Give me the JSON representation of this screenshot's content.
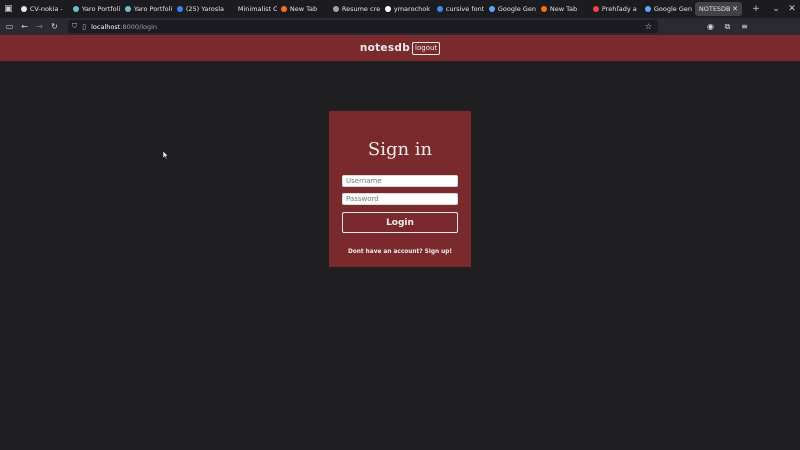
{
  "browser": {
    "tabs": [
      {
        "label": "CV-nokia -",
        "color": "#e8e8e8"
      },
      {
        "label": "Yaro Portfoli",
        "color": "#6ec0c7"
      },
      {
        "label": "Yaro Portfoli",
        "color": "#6ec0c7"
      },
      {
        "label": "(25) Yarosla",
        "color": "#3b82f6"
      },
      {
        "label": "Minimalist C",
        "color": "#1c1b1f"
      },
      {
        "label": "New Tab",
        "color": "#f97316"
      },
      {
        "label": "Resume cre",
        "color": "#9ca3af"
      },
      {
        "label": "ymarochok",
        "color": "#ffffff"
      },
      {
        "label": "cursive font",
        "color": "#4285f4"
      },
      {
        "label": "Google Gen",
        "color": "#60a5fa"
      },
      {
        "label": "New Tab",
        "color": "#f97316"
      },
      {
        "label": "Prehľady a",
        "color": "#ef4444"
      },
      {
        "label": "Google Gen",
        "color": "#60a5fa"
      }
    ],
    "active_tab": "NOTESDB",
    "url_host": "localhost",
    "url_rest": ":8000/login"
  },
  "header": {
    "brand": "notesdb",
    "logout_label": "logout",
    "accent_color": "#7a2a2c"
  },
  "login": {
    "title": "Sign in",
    "username_placeholder": "Username",
    "password_placeholder": "Password",
    "login_label": "Login",
    "signup_text": "Dont have an account? Sign up!"
  }
}
